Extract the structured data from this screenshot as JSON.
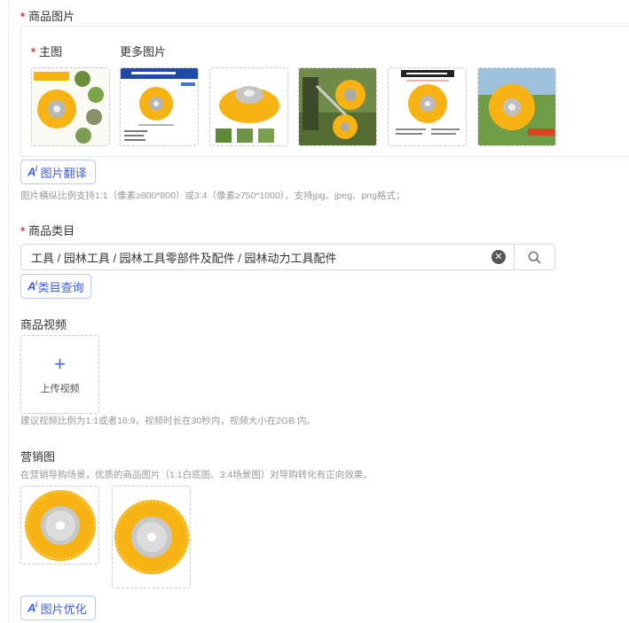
{
  "product_images": {
    "label": "商品图片",
    "main_label": "主图",
    "more_label": "更多图片",
    "thumbnails": [
      {
        "name": "main-image",
        "caption_top": "Yellow Nylon Grass Brush"
      },
      {
        "name": "more-image-1",
        "caption_top": "Yellow Nylon Grass Brush"
      },
      {
        "name": "more-image-2"
      },
      {
        "name": "more-image-3"
      },
      {
        "name": "more-image-4",
        "caption_top": "Yellow Nylon Grass Brush"
      },
      {
        "name": "more-image-5"
      }
    ],
    "ai_translate_label": "图片翻译",
    "hint": "图片横纵比例支持1:1（像素≥800*800）或3:4（像素≥750*1000），支持jpg、jpeg、png格式；"
  },
  "category": {
    "label": "商品类目",
    "value": "工具 / 园林工具 / 园林工具零部件及配件 / 园林动力工具配件",
    "ai_query_label": "类目查询"
  },
  "video": {
    "label": "商品视频",
    "upload_label": "上传视频",
    "hint": "建议视频比例为1:1或者16:9，视频时长在30秒内，视频大小在2GB 内。"
  },
  "marketing": {
    "label": "营销图",
    "hint": "在营销导购场景，优质的商品图片（1:1白底图、3:4场景图）对导购转化有正向效果。",
    "ai_optimize_label": "图片优化"
  },
  "colors": {
    "required": "#e4393c",
    "ai_blue": "#3b5cf0",
    "brush_yellow": "#f6b313"
  }
}
